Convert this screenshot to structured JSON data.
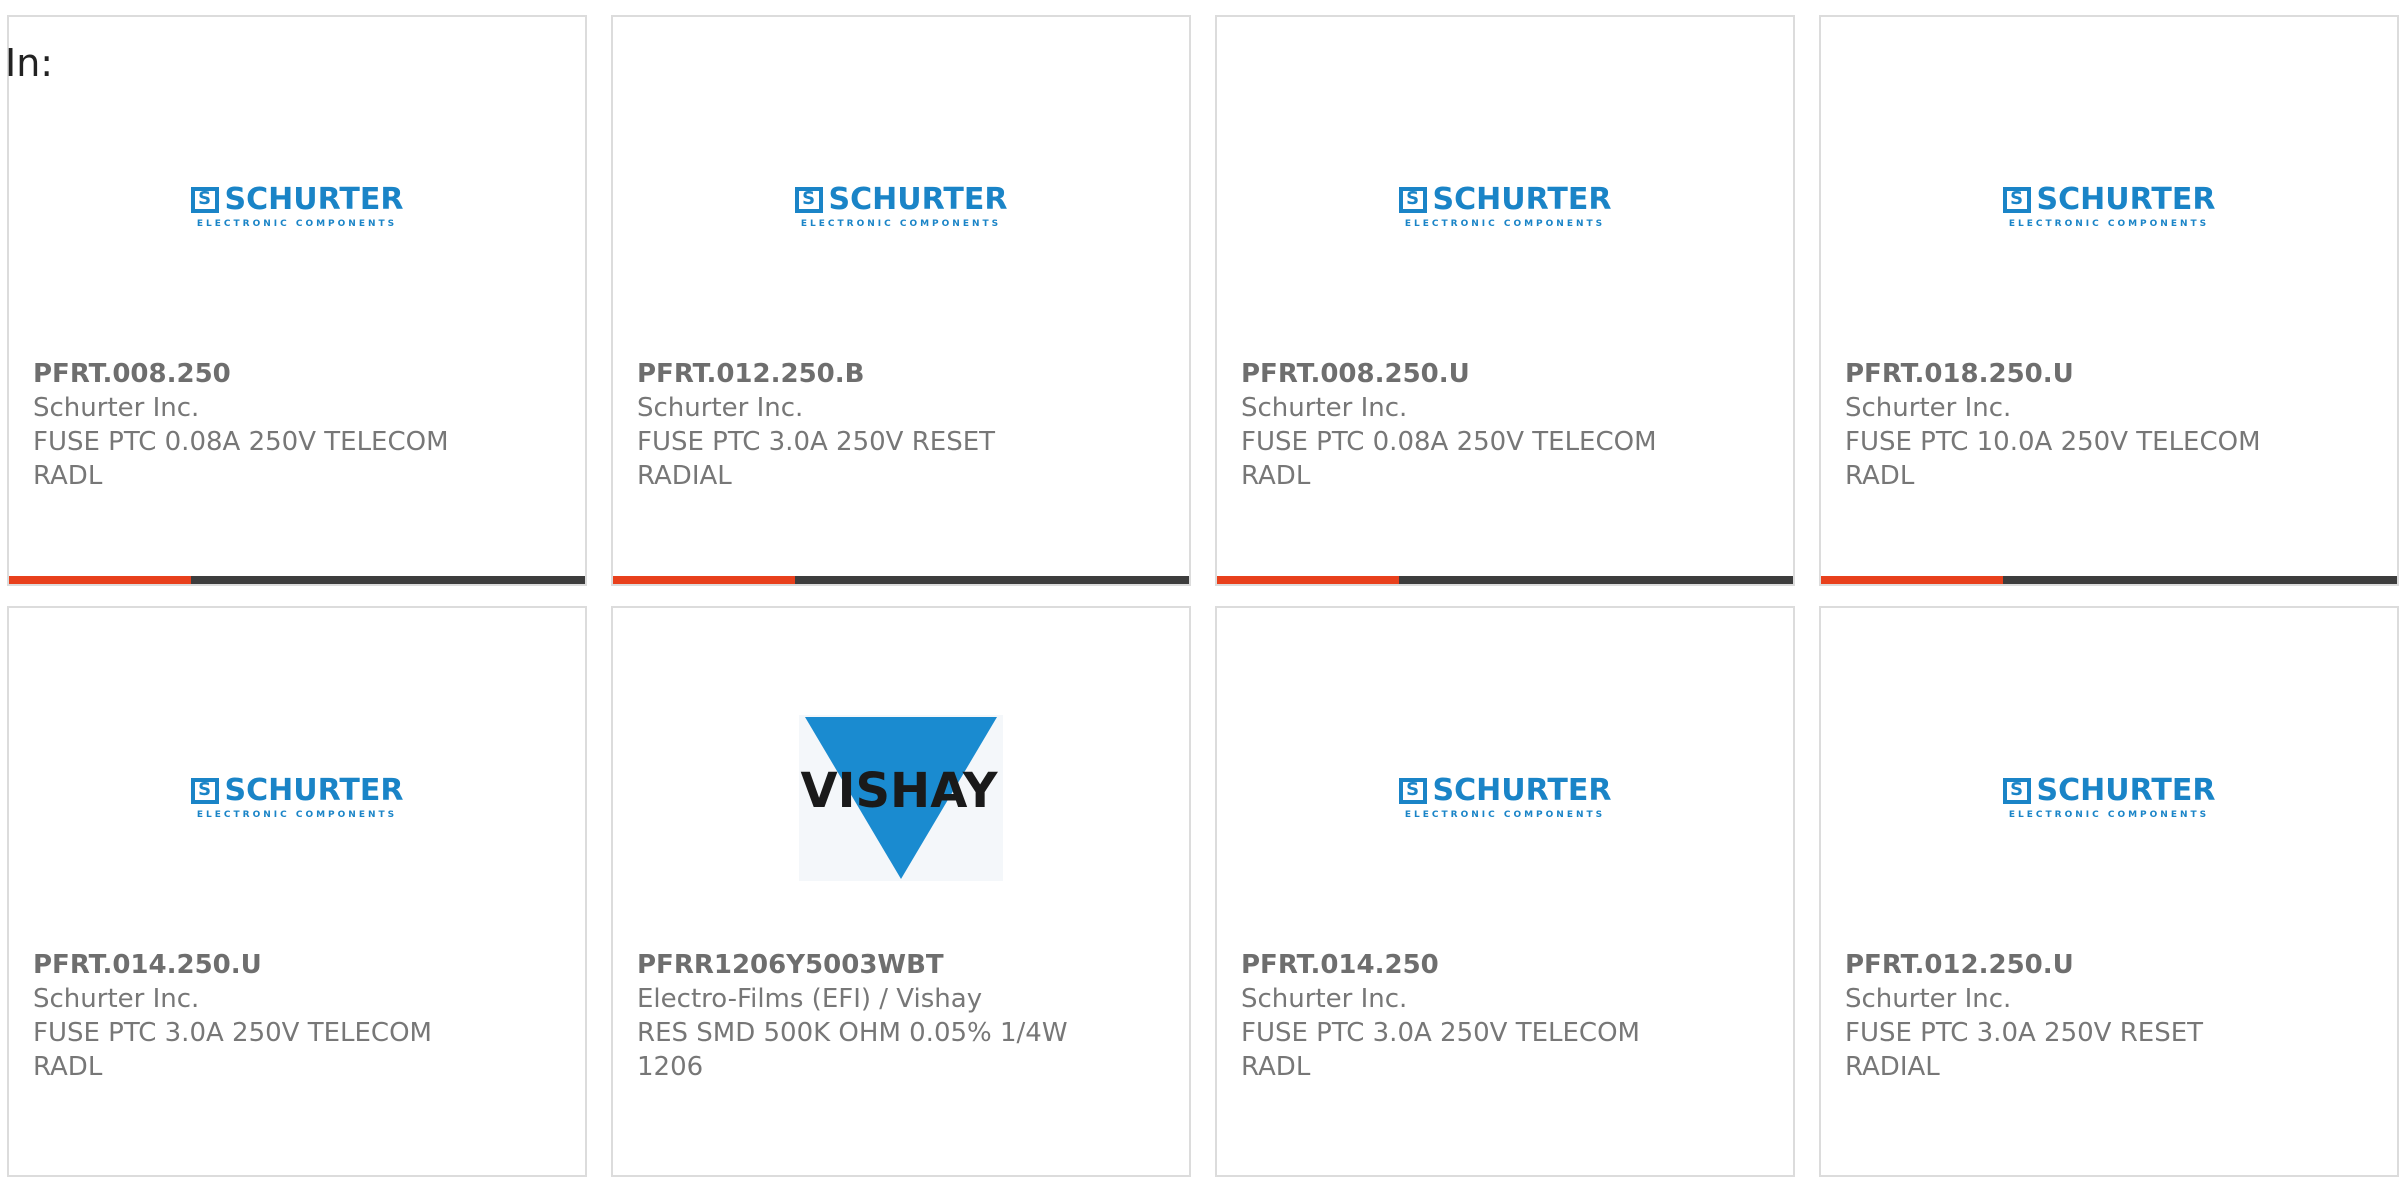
{
  "header": {
    "label": "In:"
  },
  "colors": {
    "accent": "#e8401c",
    "bar": "#3d3d3d",
    "schurter_blue": "#1a84c7",
    "vishay_blue": "#1a8bd0"
  },
  "cards": [
    {
      "part": "PFRT.008.250",
      "manufacturer": "Schurter Inc.",
      "desc1": "FUSE PTC 0.08A 250V TELECOM",
      "desc2": "RADL",
      "logo": {
        "type": "schurter",
        "name": "SCHURTER",
        "sub": "ELECTRONIC COMPONENTS"
      }
    },
    {
      "part": "PFRT.012.250.B",
      "manufacturer": "Schurter Inc.",
      "desc1": "FUSE PTC 3.0A 250V RESET",
      "desc2": "RADIAL",
      "logo": {
        "type": "schurter",
        "name": "SCHURTER",
        "sub": "ELECTRONIC COMPONENTS"
      }
    },
    {
      "part": "PFRT.008.250.U",
      "manufacturer": "Schurter Inc.",
      "desc1": "FUSE PTC 0.08A 250V TELECOM",
      "desc2": "RADL",
      "logo": {
        "type": "schurter",
        "name": "SCHURTER",
        "sub": "ELECTRONIC COMPONENTS"
      }
    },
    {
      "part": "PFRT.018.250.U",
      "manufacturer": "Schurter Inc.",
      "desc1": "FUSE PTC 10.0A 250V TELECOM",
      "desc2": "RADL",
      "logo": {
        "type": "schurter",
        "name": "SCHURTER",
        "sub": "ELECTRONIC COMPONENTS"
      }
    },
    {
      "part": "PFRT.014.250.U",
      "manufacturer": "Schurter Inc.",
      "desc1": "FUSE PTC 3.0A 250V TELECOM",
      "desc2": "RADL",
      "logo": {
        "type": "schurter",
        "name": "SCHURTER",
        "sub": "ELECTRONIC COMPONENTS"
      }
    },
    {
      "part": "PFRR1206Y5003WBT",
      "manufacturer": "Electro-Films (EFI) / Vishay",
      "desc1": "RES SMD 500K OHM 0.05% 1/4W",
      "desc2": "1206",
      "logo": {
        "type": "vishay",
        "name": "VISHAY"
      }
    },
    {
      "part": "PFRT.014.250",
      "manufacturer": "Schurter Inc.",
      "desc1": "FUSE PTC 3.0A 250V TELECOM",
      "desc2": "RADL",
      "logo": {
        "type": "schurter",
        "name": "SCHURTER",
        "sub": "ELECTRONIC COMPONENTS"
      }
    },
    {
      "part": "PFRT.012.250.U",
      "manufacturer": "Schurter Inc.",
      "desc1": "FUSE PTC 3.0A 250V RESET",
      "desc2": "RADIAL",
      "logo": {
        "type": "schurter",
        "name": "SCHURTER",
        "sub": "ELECTRONIC COMPONENTS"
      }
    }
  ]
}
